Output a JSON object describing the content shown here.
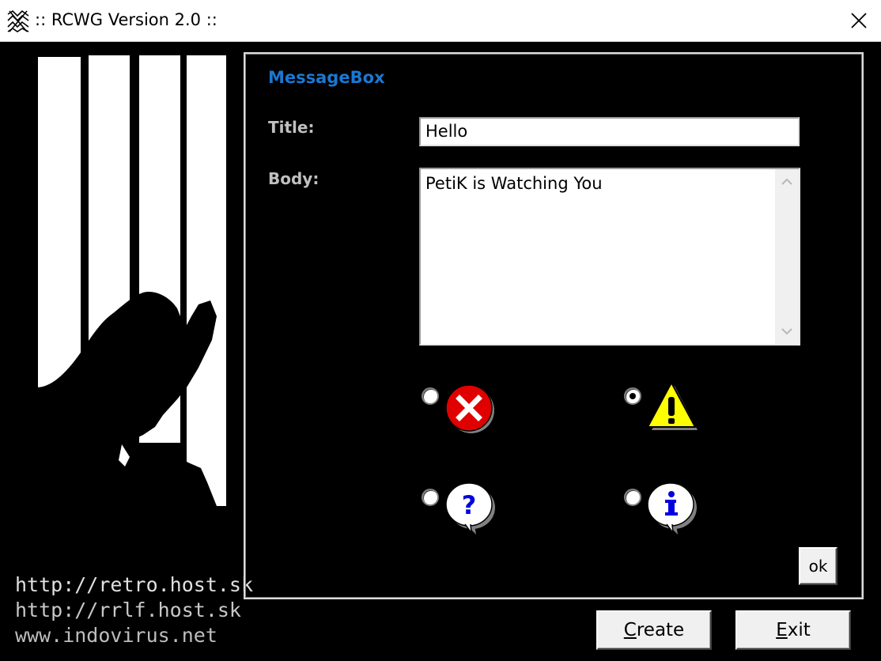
{
  "window": {
    "title": ":: RCWG Version 2.0 ::",
    "icons": {
      "app": "pattern-app-icon",
      "close": "close-icon"
    }
  },
  "sidebar": {
    "image": "silhouette-behind-bars-image",
    "links": [
      "http://retro.host.sk",
      "http://rrlf.host.sk",
      "www.indovirus.net"
    ]
  },
  "panel": {
    "heading": "MessageBox",
    "title_label": "Title:",
    "title_value": "Hello",
    "body_label": "Body:",
    "body_value": "PetiK is Watching You",
    "icon_options": [
      {
        "icon": "error-icon",
        "selected": false
      },
      {
        "icon": "warning-icon",
        "selected": true
      },
      {
        "icon": "question-icon",
        "selected": false
      },
      {
        "icon": "information-icon",
        "selected": false
      }
    ],
    "ok_label": "ok"
  },
  "footer": {
    "create_label_mnemonic": "C",
    "create_label_rest": "reate",
    "exit_label_mnemonic": "E",
    "exit_label_rest": "xit"
  },
  "colors": {
    "heading": "#1a78d2",
    "label": "#c0c0c0",
    "background": "#000000"
  }
}
